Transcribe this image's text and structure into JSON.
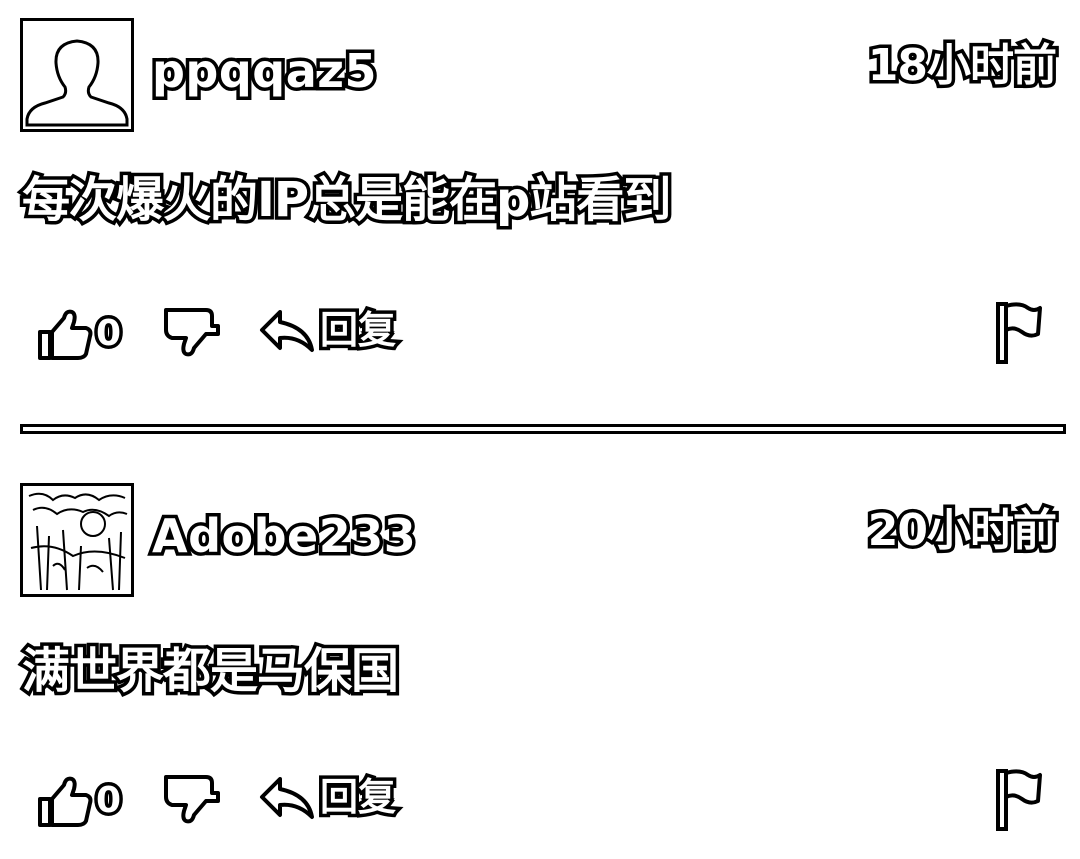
{
  "comments": [
    {
      "username": "ppqqaz5",
      "timestamp": "18小时前",
      "content": "每次爆火的IP总是能在p站看到",
      "like_count": "0",
      "reply_label": "回复",
      "avatar": "default-silhouette"
    },
    {
      "username": "Adobe233",
      "timestamp": "20小时前",
      "content": "满世界都是马保国",
      "like_count": "0",
      "reply_label": "回复",
      "avatar": "photo"
    }
  ],
  "icons": {
    "like": "thumbs-up-icon",
    "dislike": "thumbs-down-icon",
    "reply": "reply-arrow-icon",
    "report": "flag-icon"
  },
  "colors": {
    "foreground": "#000000",
    "background": "#ffffff"
  }
}
